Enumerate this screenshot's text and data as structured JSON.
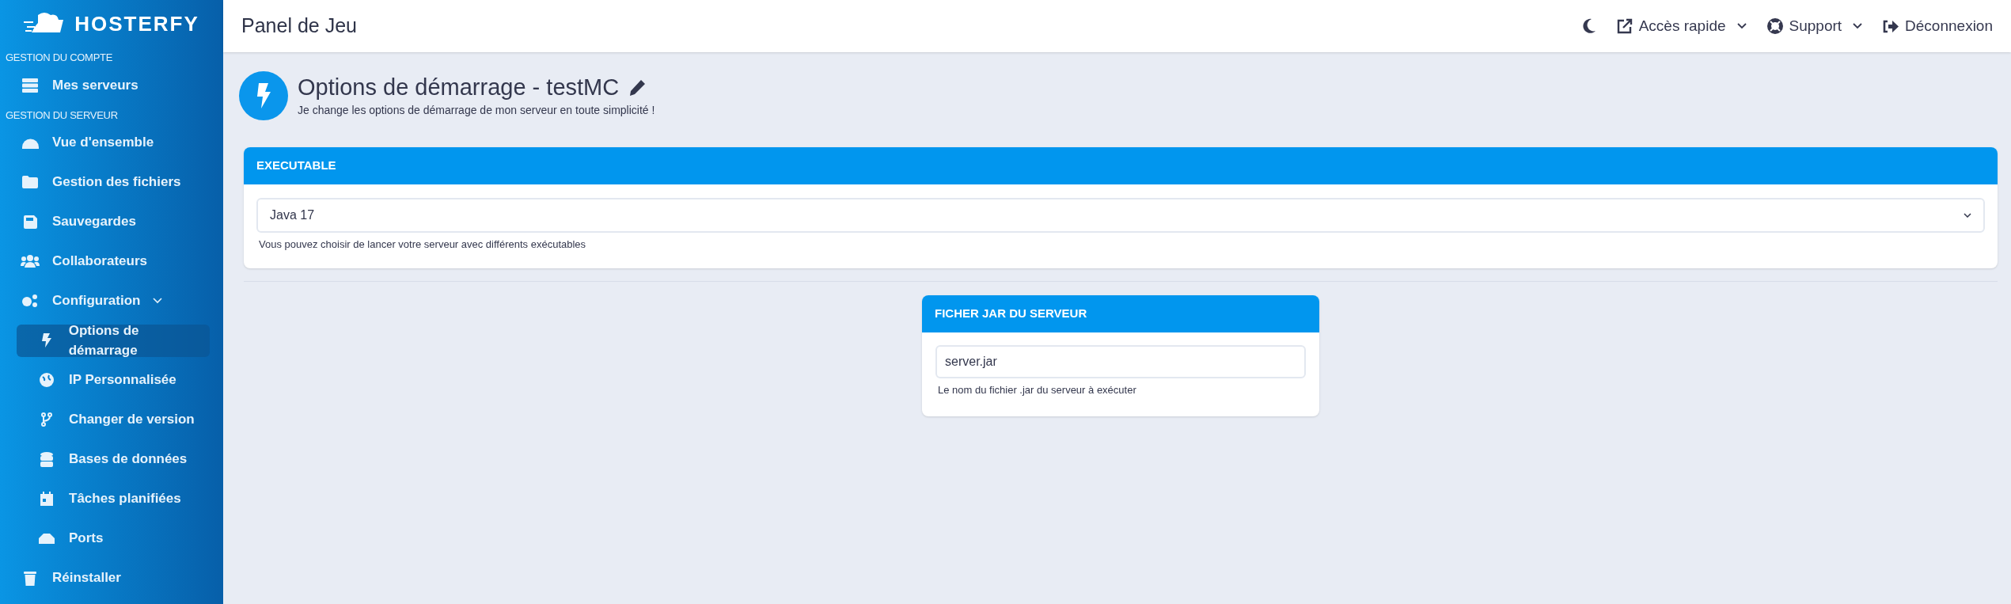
{
  "sidebar": {
    "logo": "HOSTERFY",
    "sections": [
      {
        "label": "GESTION DU COMPTE",
        "items": [
          {
            "label": "Mes serveurs",
            "selected": false
          }
        ]
      },
      {
        "label": "GESTION DU SERVEUR",
        "items": [
          {
            "label": "Vue d'ensemble",
            "selected": false
          },
          {
            "label": "Gestion des fichiers",
            "selected": false
          },
          {
            "label": "Sauvegardes",
            "selected": false
          },
          {
            "label": "Collaborateurs",
            "selected": false
          },
          {
            "label": "Configuration",
            "selected": false,
            "expanded": true,
            "children": [
              {
                "label": "Options de démarrage",
                "selected": true
              },
              {
                "label": "IP Personnalisée",
                "selected": false
              },
              {
                "label": "Changer de version",
                "selected": false
              },
              {
                "label": "Bases de données",
                "selected": false
              },
              {
                "label": "Tâches planifiées",
                "selected": false
              },
              {
                "label": "Ports",
                "selected": false
              }
            ]
          },
          {
            "label": "Réinstaller",
            "selected": false
          }
        ]
      }
    ]
  },
  "header": {
    "title": "Panel de Jeu",
    "actions": [
      {
        "label": "Accès rapide",
        "dropdown": true
      },
      {
        "label": "Support",
        "dropdown": true
      },
      {
        "label": "Déconnexion",
        "dropdown": false
      }
    ]
  },
  "page": {
    "title": "Options de démarrage - testMC",
    "subtitle": "Je change les options de démarrage de mon serveur en toute simplicité !"
  },
  "executable_card": {
    "header": "EXECUTABLE",
    "value": "Java 17",
    "help": "Vous pouvez choisir de lancer votre serveur avec différents exécutables"
  },
  "jar_card": {
    "header": "FICHER JAR DU SERVEUR",
    "value": "server.jar",
    "help": "Le nom du fichier .jar du serveur à exécuter"
  }
}
